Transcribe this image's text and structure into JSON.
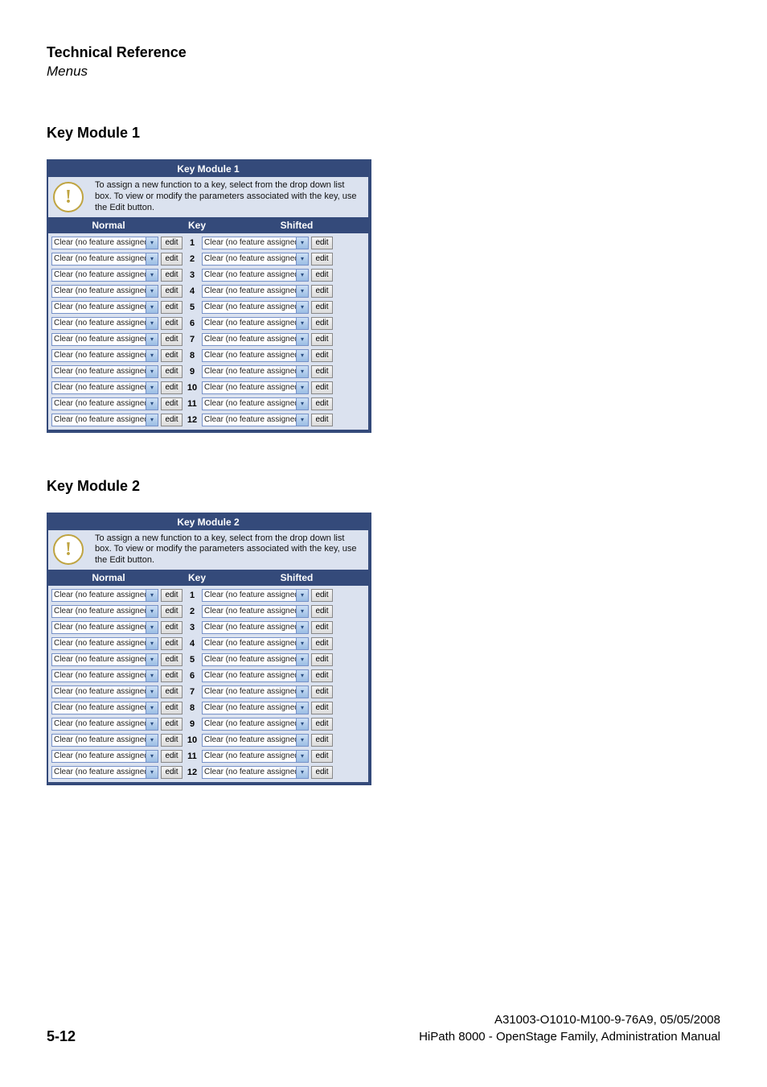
{
  "header": {
    "title": "Technical Reference",
    "subtitle": "Menus"
  },
  "sections": [
    {
      "heading": "Key Module 1",
      "module_title": "Key Module 1"
    },
    {
      "heading": "Key Module 2",
      "module_title": "Key Module 2"
    }
  ],
  "module_info_text": "To assign a new function to a key, select from the drop down list box. To view or modify the parameters associated with the key, use the Edit button.",
  "module_info_glyph": "!",
  "cols": {
    "normal": "Normal",
    "key": "Key",
    "shifted": "Shifted"
  },
  "select_text": "Clear (no feature assigned)",
  "edit_label": "edit",
  "key_count": 12,
  "footer": {
    "page": "5-12",
    "right1": "A31003-O1010-M100-9-76A9, 05/05/2008",
    "right2": "HiPath 8000 - OpenStage Family, Administration Manual"
  }
}
